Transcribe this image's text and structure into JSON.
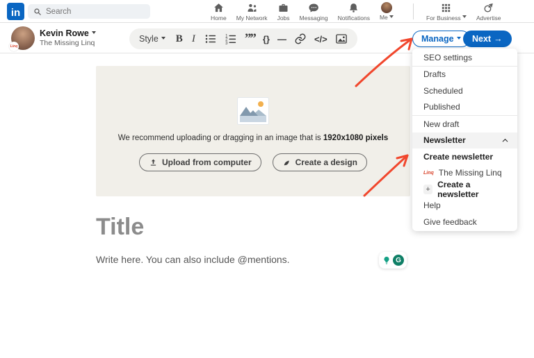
{
  "brand": {
    "logo_text": "in",
    "accent_blue": "#0a66c2"
  },
  "topnav": {
    "search_placeholder": "Search",
    "items": [
      {
        "label": "Home",
        "icon": "home-icon"
      },
      {
        "label": "My Network",
        "icon": "network-icon"
      },
      {
        "label": "Jobs",
        "icon": "briefcase-icon"
      },
      {
        "label": "Messaging",
        "icon": "chat-icon"
      },
      {
        "label": "Notifications",
        "icon": "bell-icon"
      },
      {
        "label": "Me",
        "icon": "avatar"
      }
    ],
    "for_business_label": "For Business",
    "advertise_label": "Advertise"
  },
  "editor_header": {
    "author_name": "Kevin Rowe",
    "author_subtitle": "The Missing Linq",
    "toolbar": {
      "style_label": "Style",
      "bold": "B",
      "italic": "I"
    },
    "manage_label": "Manage",
    "next_label": "Next",
    "next_arrow": "→"
  },
  "manage_menu": {
    "items": [
      {
        "label": "SEO settings"
      },
      {
        "label": "Drafts"
      },
      {
        "label": "Scheduled"
      },
      {
        "label": "Published"
      },
      {
        "label": "New draft"
      },
      {
        "label": "Newsletter",
        "expanded": true
      },
      {
        "label": "Create newsletter"
      },
      {
        "label": "The Missing Linq"
      },
      {
        "label": "Create a newsletter"
      },
      {
        "label": "Help"
      },
      {
        "label": "Give feedback"
      }
    ],
    "logo_badge": "Linq"
  },
  "content": {
    "upload": {
      "hint_prefix": "We recommend uploading or dragging in an image that is ",
      "hint_bold": "1920x1080 pixels",
      "upload_button": "Upload from computer",
      "design_button": "Create a design"
    },
    "title_placeholder": "Title",
    "body_placeholder": "Write here. You can also include @mentions.",
    "grammarly_g": "G"
  },
  "icons": {
    "quote": "””",
    "inline_code": "{}",
    "divider": "—",
    "code_block": "</>",
    "plus": "+"
  },
  "annotation": {
    "arrow_color": "#f1472d"
  }
}
